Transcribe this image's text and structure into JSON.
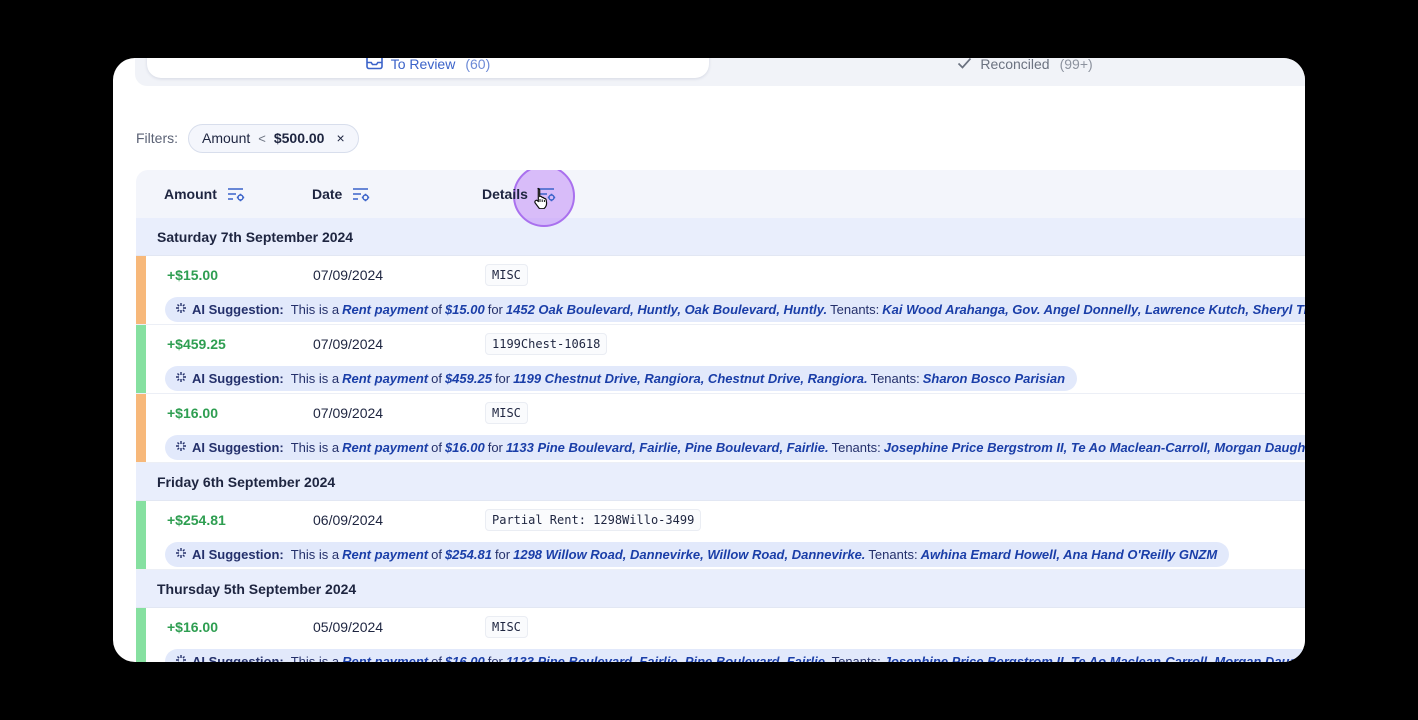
{
  "tabs": [
    {
      "label": "To Review",
      "count": "(60)"
    },
    {
      "label": "Reconciled",
      "count": "(99+)"
    }
  ],
  "filters": {
    "label": "Filters:",
    "chip": {
      "field": "Amount",
      "operator": "<",
      "value": "$500.00",
      "remove": "×"
    }
  },
  "table": {
    "headers": {
      "amount": "Amount",
      "date": "Date",
      "details": "Details"
    }
  },
  "ai": {
    "label": "AI Suggestion:",
    "prefix": "This is a",
    "type": "Rent payment",
    "of": "of",
    "for": "for",
    "tenants": "Tenants:"
  },
  "groups": [
    {
      "date_label": "Saturday 7th September 2024",
      "transactions": [
        {
          "amount": "+$15.00",
          "date": "07/09/2024",
          "reference": "MISC",
          "status_color": "#f7b87a",
          "ai_amount": "$15.00",
          "ai_property": "1452 Oak Boulevard, Huntly, Oak Boulevard, Huntly.",
          "ai_tenants": "Kai Wood Arahanga, Gov. Angel Donnelly, Lawrence Kutch, Sheryl Tillman-"
        },
        {
          "amount": "+$459.25",
          "date": "07/09/2024",
          "reference": "1199Chest-10618",
          "status_color": "#86e0a0",
          "ai_amount": "$459.25",
          "ai_property": "1199 Chestnut Drive, Rangiora, Chestnut Drive, Rangiora.",
          "ai_tenants": "Sharon Bosco Parisian"
        },
        {
          "amount": "+$16.00",
          "date": "07/09/2024",
          "reference": "MISC",
          "status_color": "#f7b87a",
          "ai_amount": "$16.00",
          "ai_property": "1133 Pine Boulevard, Fairlie, Pine Boulevard, Fairlie.",
          "ai_tenants": "Josephine Price Bergstrom II, Te Ao Maclean-Carroll, Morgan Daugherty-Kh"
        }
      ]
    },
    {
      "date_label": "Friday 6th September 2024",
      "transactions": [
        {
          "amount": "+$254.81",
          "date": "06/09/2024",
          "reference": "Partial Rent: 1298Willo-3499",
          "status_color": "#86e0a0",
          "ai_amount": "$254.81",
          "ai_property": "1298 Willow Road, Dannevirke, Willow Road, Dannevirke.",
          "ai_tenants": "Awhina Emard Howell, Ana Hand O'Reilly GNZM"
        }
      ]
    },
    {
      "date_label": "Thursday 5th September 2024",
      "transactions": [
        {
          "amount": "+$16.00",
          "date": "05/09/2024",
          "reference": "MISC",
          "status_color": "#86e0a0",
          "ai_amount": "$16.00",
          "ai_property": "1133 Pine Boulevard, Fairlie, Pine Boulevard, Fairlie.",
          "ai_tenants": "Josephine Price Bergstrom II, Te Ao Maclean-Carroll, Morgan Daugherty-Kh"
        }
      ]
    }
  ],
  "icons": {
    "tab_review": "inbox-icon",
    "tab_reconciled": "check-icon",
    "column_filter": "filter-settings-icon",
    "ai": "sparkle-icon",
    "cursor": "pointer-hand-icon"
  },
  "colors": {
    "accent": "#3b63c9",
    "positive": "#2e9e51",
    "pending": "#f7b87a",
    "matched": "#86e0a0",
    "ai_bg": "#e2e9fb",
    "group_bg": "#e9eefc"
  }
}
